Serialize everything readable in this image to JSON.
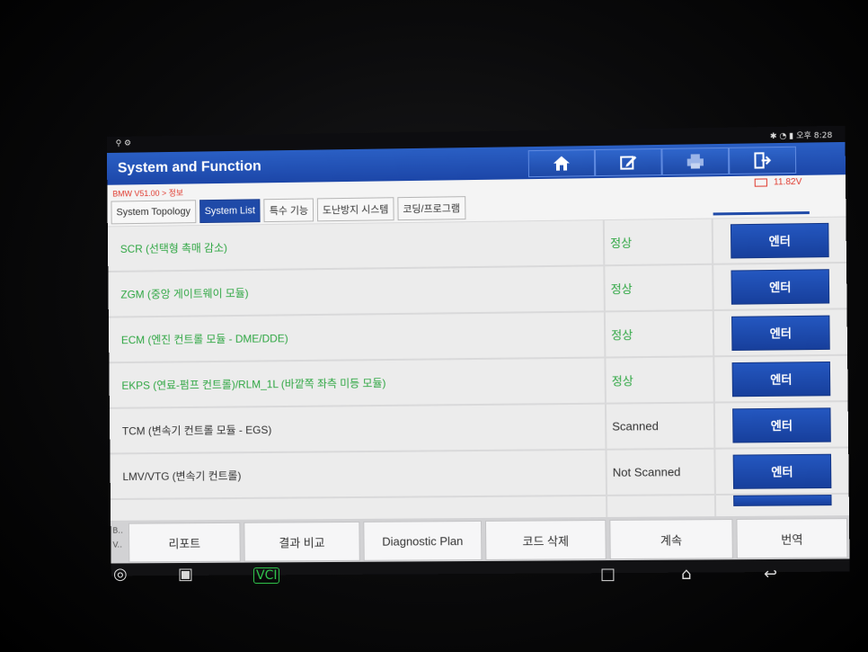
{
  "statusbar": {
    "left": "⚲ ⚙",
    "right": "✱ ◔ ▮ 오후 8:28"
  },
  "header": {
    "title": "System and Function",
    "icons": [
      "home-icon",
      "edit-icon",
      "print-icon",
      "exit-icon"
    ]
  },
  "breadcrumb": "BMW V51.00 > 정보",
  "voltage": "11.82V",
  "tabs": [
    {
      "label": "System Topology",
      "active": false
    },
    {
      "label": "System List",
      "active": true
    },
    {
      "label": "특수 기능",
      "active": false
    },
    {
      "label": "도난방지 시스템",
      "active": false
    },
    {
      "label": "코딩/프로그램",
      "active": false
    }
  ],
  "rows": [
    {
      "name": "SCR (선택형 촉매 감소)",
      "status": "정상",
      "button": "엔터",
      "color": "#2ea642"
    },
    {
      "name": "ZGM (중앙 게이트웨이 모듈)",
      "status": "정상",
      "button": "엔터",
      "color": "#2ea642"
    },
    {
      "name": "ECM (엔진 컨트롤 모듈 - DME/DDE)",
      "status": "정상",
      "button": "엔터",
      "color": "#2ea642"
    },
    {
      "name": "EKPS (연료-펌프 컨트롤)/RLM_1L (바깥쪽 좌측 미등 모듈)",
      "status": "정상",
      "button": "엔터",
      "color": "#2ea642"
    },
    {
      "name": "TCM (변속기 컨트롤 모듈 - EGS)",
      "status": "Scanned",
      "button": "엔터",
      "color": "#333333"
    },
    {
      "name": "LMV/VTG (변속기 컨트롤)",
      "status": "Not Scanned",
      "button": "엔터",
      "color": "#333333"
    }
  ],
  "bottom": {
    "bv": [
      "B..",
      "V.."
    ],
    "buttons": [
      "리포트",
      "결과 비교",
      "Diagnostic Plan",
      "코드 삭제",
      "계속",
      "번역"
    ]
  },
  "sysnav": {
    "browser": "◎",
    "gallery": "▣",
    "vci": "VCI",
    "recents": "□",
    "home": "⌂",
    "back": "↩"
  }
}
